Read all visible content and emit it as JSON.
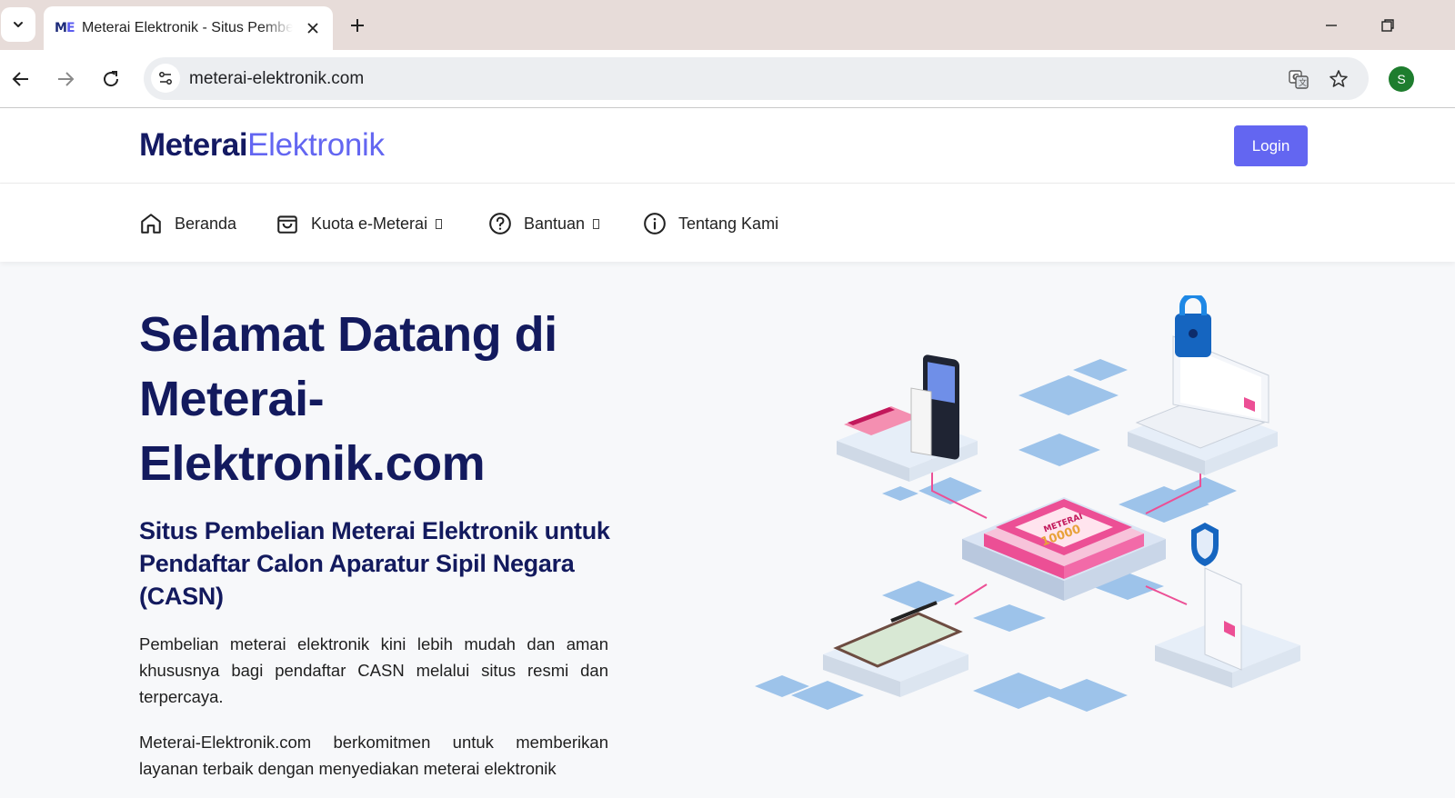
{
  "browser": {
    "tab": {
      "favicon_text_a": "M",
      "favicon_text_b": "E",
      "title": "Meterai Elektronik - Situs Pembelian Meterai Elektronik"
    },
    "address_bar": {
      "url": "meterai-elektronik.com"
    },
    "profile_initial": "S",
    "icons": {
      "tab_menu": "chevron-down-icon",
      "tab_close": "close-icon",
      "new_tab": "plus-icon",
      "minimize": "minimize-icon",
      "restore": "restore-icon",
      "back": "arrow-left-icon",
      "forward": "arrow-right-icon",
      "reload": "reload-icon",
      "site_info": "tune-icon",
      "translate": "translate-icon",
      "bookmark": "star-icon"
    }
  },
  "site": {
    "logo_bold": "Meterai",
    "logo_light": "Elektronik",
    "login_label": "Login",
    "nav": [
      {
        "label": "Beranda",
        "icon": "home-icon"
      },
      {
        "label": "Kuota e-Meterai",
        "icon": "shopping-bag-icon",
        "has_dropdown": true
      },
      {
        "label": "Bantuan",
        "icon": "help-circle-icon",
        "has_dropdown": true
      },
      {
        "label": "Tentang Kami",
        "icon": "info-circle-icon"
      }
    ],
    "hero": {
      "title": "Selamat Datang di Meterai-Elektronik.com",
      "subtitle": "Situs Pembelian Meterai Elektronik untuk Pendaftar Calon Aparatur Sipil Negara (CASN)",
      "paragraph_1": "Pembelian meterai elektronik kini lebih mudah dan aman khususnya bagi pendaftar CASN melalui situs resmi dan terpercaya.",
      "paragraph_2": "Meterai-Elektronik.com berkomitmen untuk memberikan layanan terbaik dengan menyediakan meterai elektronik",
      "illustration_stamp_text": "METERAI",
      "illustration_stamp_value": "10000"
    }
  },
  "colors": {
    "brand_dark": "#131a5e",
    "brand_accent": "#6366f1",
    "stamp_pink": "#ec4f95",
    "tile_blue": "#7fb2e5"
  }
}
